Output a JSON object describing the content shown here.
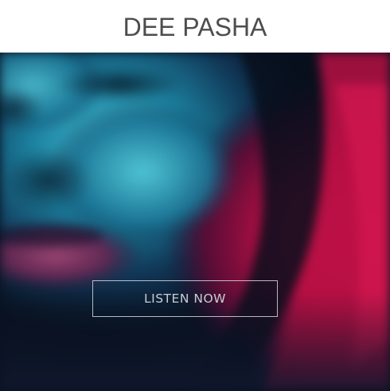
{
  "header": {
    "title": "DEE PASHA"
  },
  "hero": {
    "image": "blurred-face-portrait",
    "cta_label": "LISTEN NOW"
  },
  "colors": {
    "header_bg": "#ffffff",
    "title_text": "#4d4d4d",
    "hero_teal": "#2aa3c0",
    "hero_magenta": "#d4104a",
    "hero_navy": "#0a1424"
  }
}
